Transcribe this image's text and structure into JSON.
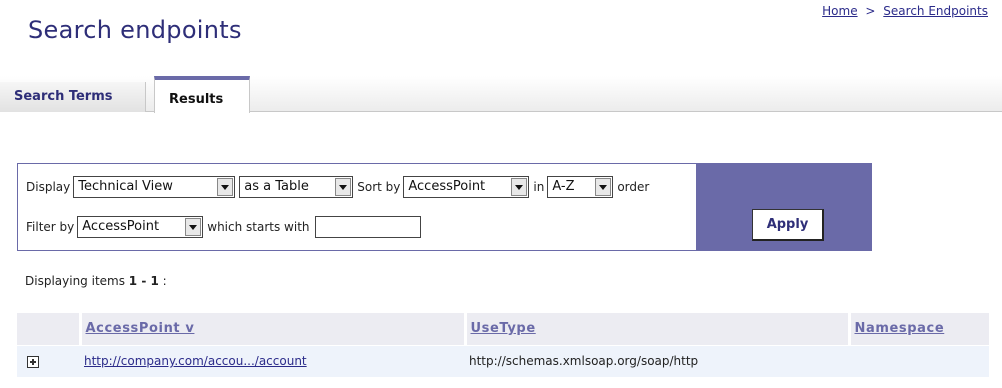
{
  "breadcrumb": {
    "home": "Home",
    "separator": ">",
    "current": "Search Endpoints"
  },
  "page": {
    "title": "Search endpoints"
  },
  "tabs": [
    {
      "label": "Search Terms",
      "active": false
    },
    {
      "label": "Results",
      "active": true
    }
  ],
  "filters": {
    "display_label": "Display",
    "view_value": "Technical View",
    "format_value": "as a Table",
    "sort_label": "Sort by",
    "sort_value": "AccessPoint",
    "in_label": "in",
    "order_value": "A-Z",
    "order_label": "order",
    "filter_label": "Filter by",
    "filter_value": "AccessPoint",
    "starts_label": "which starts with",
    "starts_value": "",
    "apply_label": "Apply",
    "panel_accent": "#6a6aa8"
  },
  "display": {
    "prefix": "Displaying items",
    "range": "1 - 1",
    "suffix": ":"
  },
  "table": {
    "columns": [
      "AccessPoint v",
      "UseType",
      "Namespace"
    ],
    "rows": [
      {
        "access_point": "http://company.com/accou.../account",
        "use_type": "http://schemas.xmlsoap.org/soap/http",
        "namespace": "",
        "icon": "expand-icon"
      }
    ]
  }
}
